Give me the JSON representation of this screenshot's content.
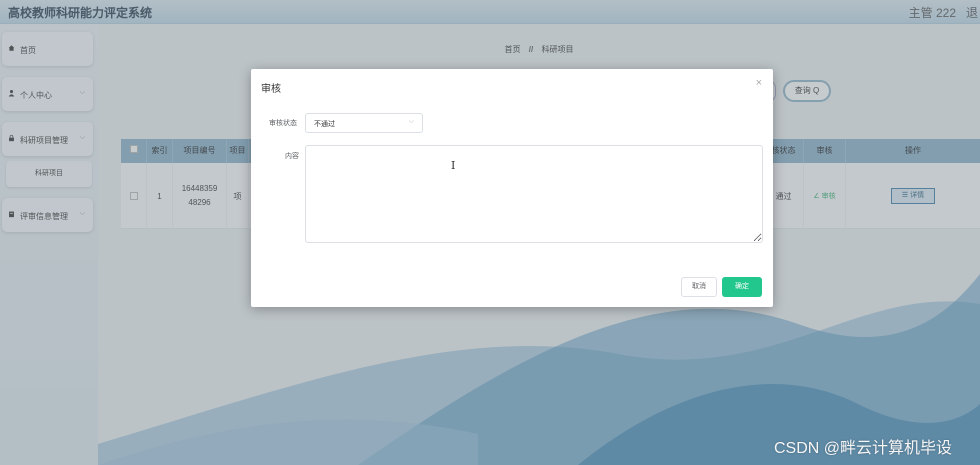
{
  "app": {
    "title": "高校教师科研能力评定系统",
    "user": "主管 222",
    "logout": "退"
  },
  "sidebar": {
    "items": [
      {
        "label": "首页",
        "icon": "home-icon"
      },
      {
        "label": "个人中心",
        "icon": "user-icon"
      },
      {
        "label": "科研项目管理",
        "icon": "lock-icon"
      },
      {
        "label": "科研项目",
        "icon": ""
      },
      {
        "label": "评审信息管理",
        "icon": "clipboard-icon"
      }
    ]
  },
  "breadcrumb": {
    "home": "首页",
    "sep": "//",
    "current": "科研项目"
  },
  "search": {
    "query_label": "查询 Q"
  },
  "table": {
    "headers": [
      "索引",
      "项目编号",
      "项目",
      "核状态",
      "审核",
      "操作"
    ],
    "row": {
      "index": "1",
      "project_no": "16448359 48296",
      "project_name": "项",
      "status": "通过",
      "audit": "∠ 审核",
      "detail": "☰ 详情"
    }
  },
  "dialog": {
    "title": "审核",
    "close": "×",
    "status_label": "审核状态",
    "status_value": "不通过",
    "content_label": "内容",
    "content_value": "",
    "cancel": "取消",
    "confirm": "确定"
  },
  "colors": {
    "accent": "#22c78d",
    "header_bar": "#8bb1ca",
    "topbar": "#bfd9e8"
  },
  "watermark": "CSDN @畔云计算机毕设"
}
